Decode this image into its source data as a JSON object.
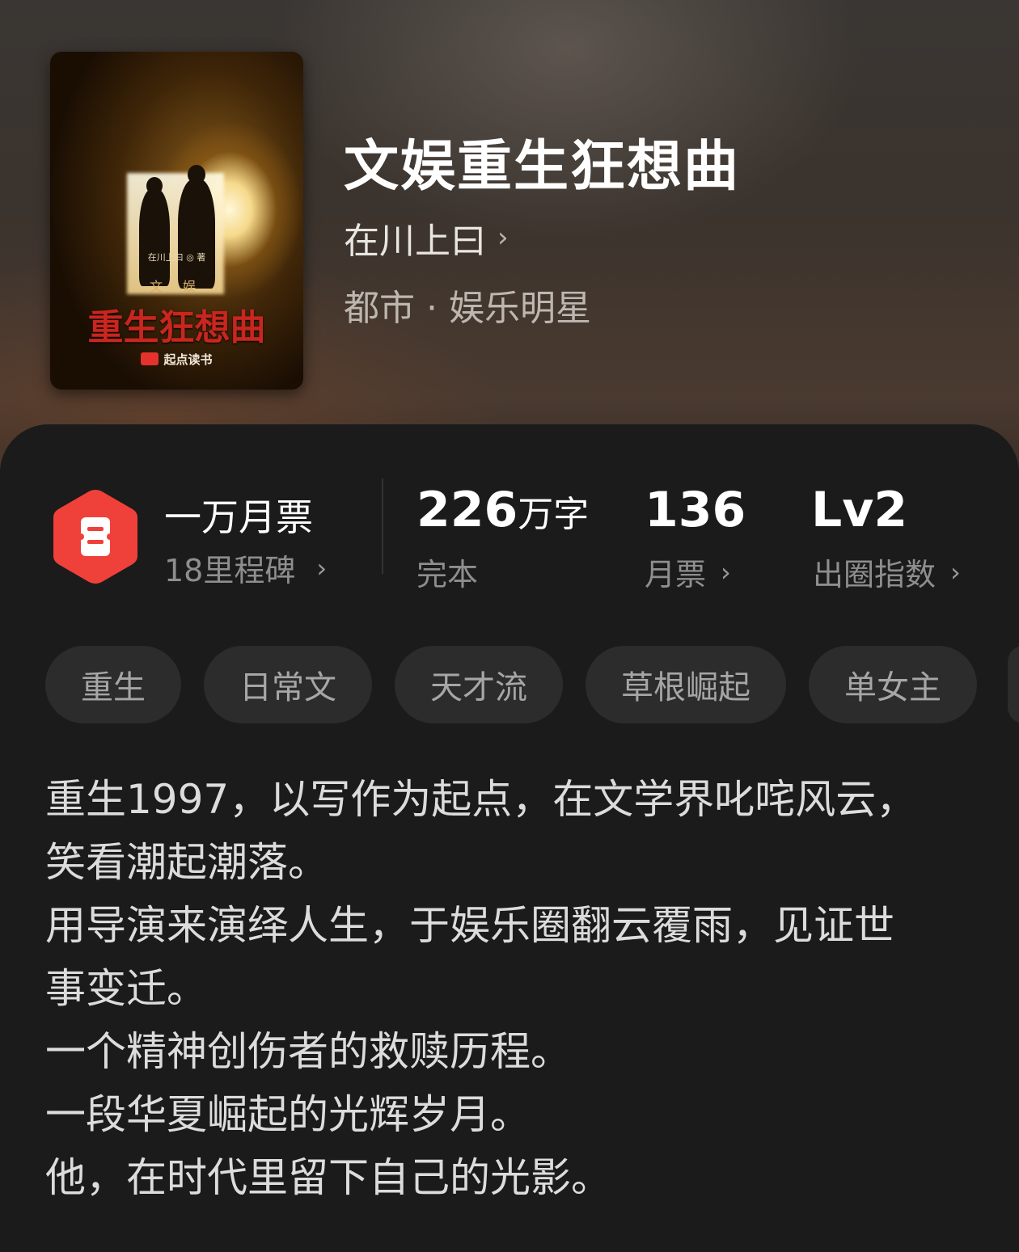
{
  "book": {
    "title": "文娱重生狂想曲",
    "author": "在川上曰",
    "author_chevron": "›",
    "genre": "都市 · 娱乐明星",
    "cover": {
      "author_line": "在川上曰 ◎ 著",
      "subtitle": "文 娱",
      "title": "重生狂想曲",
      "publisher": "起点读书"
    }
  },
  "stats": {
    "monthly_ticket": {
      "title": "一万月票",
      "subtitle": "18里程碑",
      "chevron": "›",
      "icon": "ticket-hexagon-icon",
      "icon_color": "#f0403a"
    },
    "words": {
      "value": "226",
      "unit": "万字",
      "label": "完本"
    },
    "monthly": {
      "value": "136",
      "label": "月票",
      "chevron": "›"
    },
    "influence": {
      "value": "Lv2",
      "label": "出圈指数",
      "chevron": "›"
    }
  },
  "tags": [
    "重生",
    "日常文",
    "天才流",
    "草根崛起",
    "单女主"
  ],
  "description": [
    "重生1997，以写作为起点，在文学界叱咤风云，",
    "笑看潮起潮落。",
    "用导演来演绎人生，于娱乐圈翻云覆雨，见证世",
    "事变迁。",
    "一个精神创伤者的救赎历程。",
    "一段华夏崛起的光辉岁月。",
    "他，在时代里留下自己的光影。"
  ]
}
